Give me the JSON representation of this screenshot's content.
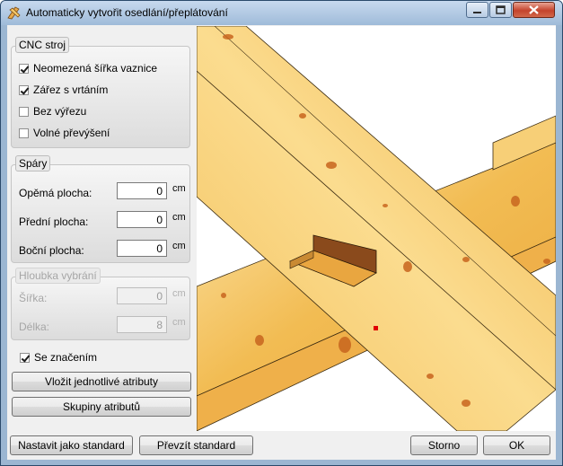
{
  "window": {
    "title": "Automaticky vytvořit osedlání/přeplátování",
    "icons": [
      "app-icon",
      "minimize-icon",
      "maximize-icon",
      "close-icon"
    ]
  },
  "cnc": {
    "title": "CNC stroj",
    "options": [
      {
        "label": "Neomezená šířka vaznice",
        "checked": true
      },
      {
        "label": "Zářez s vrtáním",
        "checked": true
      },
      {
        "label": "Bez výřezu",
        "checked": false
      },
      {
        "label": "Volné převýšení",
        "checked": false
      }
    ]
  },
  "gaps": {
    "title": "Spáry",
    "fields": [
      {
        "label": "Opěmá plocha:",
        "value": "0",
        "unit": "cm"
      },
      {
        "label": "Přední plocha:",
        "value": "0",
        "unit": "cm"
      },
      {
        "label": "Boční plocha:",
        "value": "0",
        "unit": "cm"
      }
    ]
  },
  "depth": {
    "title": "Hloubka vybrání",
    "fields": [
      {
        "label": "Šířka:",
        "value": "0",
        "unit": "cm"
      },
      {
        "label": "Délka:",
        "value": "8",
        "unit": "cm"
      }
    ]
  },
  "marking": {
    "label": "Se značením",
    "checked": true
  },
  "buttons": {
    "insert_attributes": "Vložit jednotlivé atributy",
    "attribute_groups": "Skupiny atributů",
    "set_default": "Nastavit jako standard",
    "take_default": "Převzít standard",
    "cancel": "Storno",
    "ok": "OK"
  },
  "colors": {
    "wood": "#f0b94e",
    "wood_light": "#fbe3a4",
    "knot": "#c8651e",
    "marker": "#e00000"
  }
}
